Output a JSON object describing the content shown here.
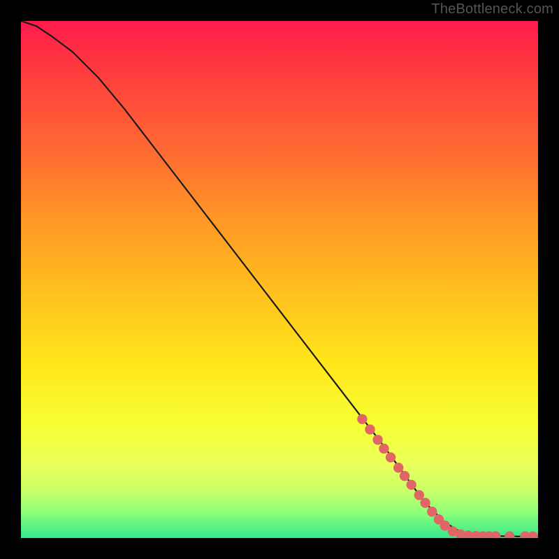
{
  "watermark": "TheBottleneck.com",
  "chart_data": {
    "type": "line",
    "title": "",
    "xlabel": "",
    "ylabel": "",
    "xlim": [
      0,
      100
    ],
    "ylim": [
      0,
      100
    ],
    "grid": false,
    "legend": false,
    "series": [
      {
        "name": "curve",
        "x": [
          0,
          3,
          6,
          10,
          15,
          20,
          30,
          40,
          50,
          60,
          70,
          78,
          82,
          85,
          88,
          92,
          96,
          100
        ],
        "y": [
          100,
          99,
          97,
          94,
          89,
          83,
          70,
          57,
          44,
          31,
          18,
          7,
          3,
          1.2,
          0.6,
          0.4,
          0.3,
          0.3
        ]
      }
    ],
    "markers": [
      {
        "x": 66.0,
        "y": 23.0
      },
      {
        "x": 67.5,
        "y": 21.0
      },
      {
        "x": 69.0,
        "y": 19.0
      },
      {
        "x": 70.2,
        "y": 17.3
      },
      {
        "x": 71.5,
        "y": 15.6
      },
      {
        "x": 73.0,
        "y": 13.6
      },
      {
        "x": 74.2,
        "y": 12.0
      },
      {
        "x": 75.5,
        "y": 10.3
      },
      {
        "x": 77.0,
        "y": 8.3
      },
      {
        "x": 78.2,
        "y": 6.8
      },
      {
        "x": 79.5,
        "y": 5.1
      },
      {
        "x": 80.8,
        "y": 3.6
      },
      {
        "x": 82.0,
        "y": 2.4
      },
      {
        "x": 83.5,
        "y": 1.3
      },
      {
        "x": 85.0,
        "y": 0.7
      },
      {
        "x": 86.5,
        "y": 0.5
      },
      {
        "x": 88.0,
        "y": 0.4
      },
      {
        "x": 89.3,
        "y": 0.35
      },
      {
        "x": 90.5,
        "y": 0.35
      },
      {
        "x": 91.8,
        "y": 0.35
      },
      {
        "x": 94.5,
        "y": 0.33
      },
      {
        "x": 97.5,
        "y": 0.33
      },
      {
        "x": 99.0,
        "y": 0.33
      }
    ],
    "background_gradient": {
      "top": "#ff1a4d",
      "mid": "#ffe61a",
      "bottom": "#35e88a"
    }
  }
}
